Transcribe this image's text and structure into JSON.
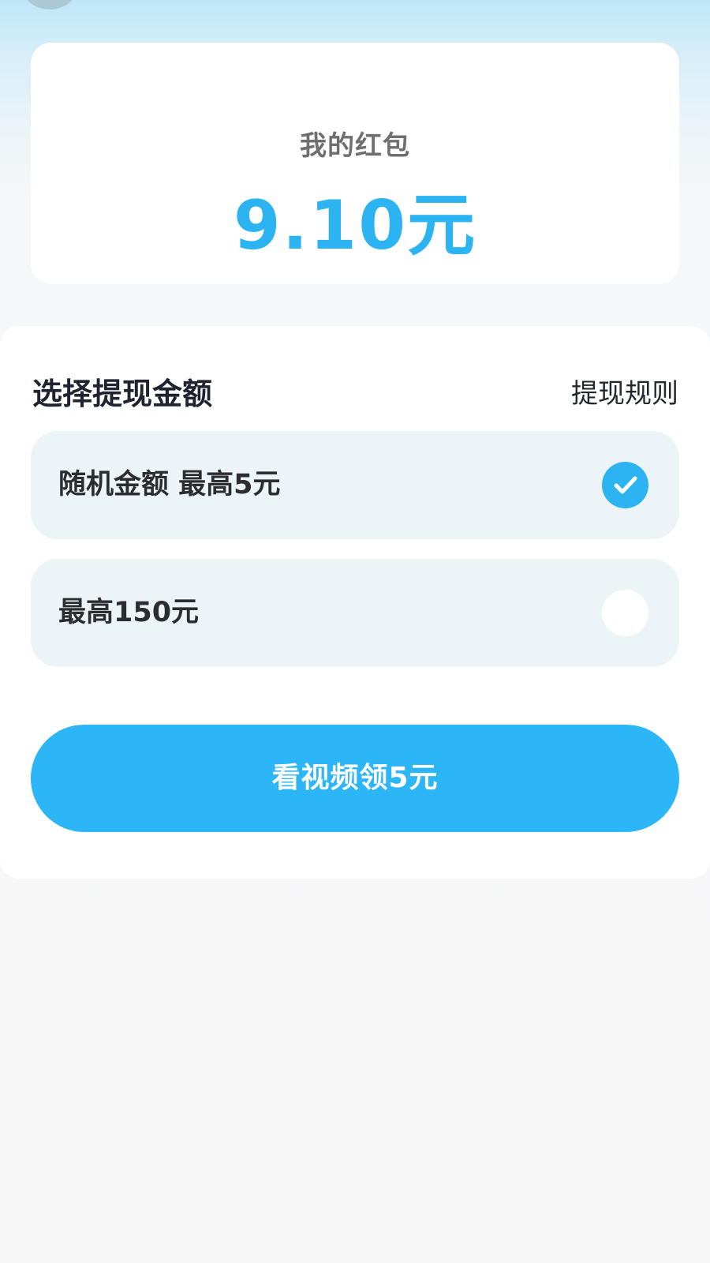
{
  "colors": {
    "accent_blue": "#2cb3f2",
    "button_blue": "#2cb5f7",
    "card_white": "#ffffff",
    "option_bg": "#ecf4f8",
    "page_bg": "#f7f7f8",
    "top_bg": "#bfe6f8"
  },
  "balance_card": {
    "title": "我的红包",
    "amount": "9.10元"
  },
  "withdraw": {
    "section_title": "选择提现金额",
    "rules_link": "提现规则",
    "options": [
      {
        "label": "随机金额 最高5元",
        "selected": true,
        "indicator_icon": "check-icon"
      },
      {
        "label": "最高150元",
        "selected": false,
        "indicator_icon": "radio-empty-icon"
      }
    ],
    "button_label": "看视频领5元"
  }
}
